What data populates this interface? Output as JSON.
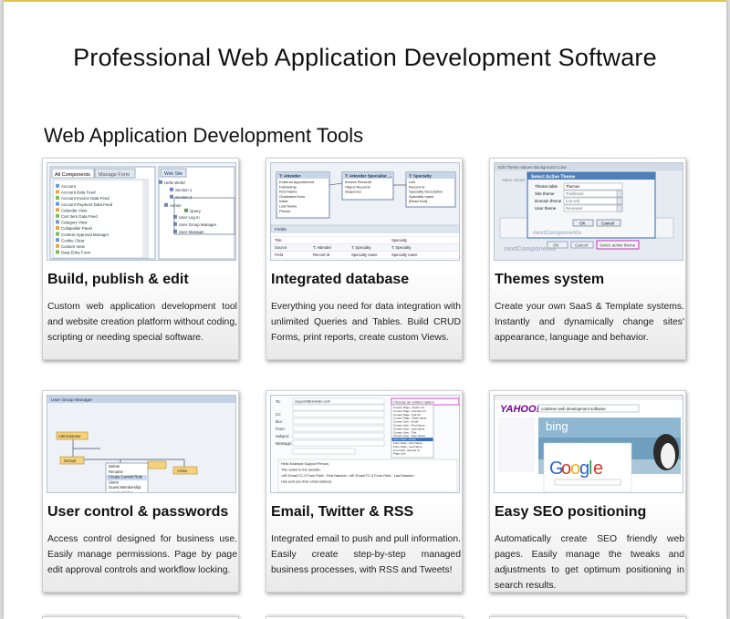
{
  "page": {
    "title": "Professional Web Application Development Software",
    "section_title": "Web Application Development Tools"
  },
  "cards": [
    {
      "title": "Build, publish & edit",
      "description": "Custom web application development tool and website creation platform without coding, scripting or needing special software.",
      "thumb": {
        "tab_active": "All Components",
        "tab_inactive": "Manage Form",
        "right_tab": "Web Site",
        "components": [
          "Account",
          "Account Data Feed",
          "Account Invoice Data Feed",
          "Account Payment Data Feed",
          "Calendar View",
          "Cart Item Data Feed",
          "Category View",
          "Collapsible Panel",
          "Content Approval Manager",
          "Cookie Clear",
          "Custom View",
          "Data Entry Form"
        ],
        "tree": [
          "Hello World",
          "Section 1",
          "Section 2",
          "Admin",
          "Query",
          "User Log In",
          "User Group Manager",
          "User Manager"
        ]
      }
    },
    {
      "title": "Integrated database",
      "description": "Everything you need for data integration with unlimited Queries and Tables. Build CRUD Forms, print reports, create custom Views.",
      "thumb": {
        "tables": [
          "T: Attender",
          "T: Attender Specialist_...",
          "T: Specialty"
        ],
        "table1_fields": [
          "External Appointment",
          "Fellowship",
          "First Name",
          "Graduated from",
          "Initial",
          "Last Name",
          "Picture"
        ],
        "table2_fields": [
          "Invoice Record#",
          "Object Records",
          "Sequence"
        ],
        "table3_fields": [
          "Link",
          "Record Id",
          "Specialty Description",
          "Specialty name",
          "[Read Sort]"
        ],
        "fields_label": "Fields",
        "grid_rows": [
          "Title",
          "Source",
          "Field"
        ],
        "grid_values": [
          "Specialty",
          "T: Attender",
          "T: Specialty",
          "T: Specialty",
          "Record Id",
          "Specialty name",
          "Specialty name"
        ]
      }
    },
    {
      "title": "Themes system",
      "description": "Create your own SaaS & Template systems. Instantly and dynamically change sites' appearance, language and behavior.",
      "thumb": {
        "bg_header": "Edit Theme Values Background Color",
        "dialog_title": "Select Active Theme",
        "dialog_rows": [
          "Theme table",
          "Site theme",
          "Domain theme",
          "User theme"
        ],
        "dialog_values": [
          "Themes",
          "Traditional",
          "(not set)",
          "Reviewed"
        ],
        "ok": "OK",
        "cancel": "Cancel",
        "brand": "nextComponents",
        "select_active": "Select active theme",
        "bg_value": "Value stored"
      }
    },
    {
      "title": "User control & passwords",
      "description": "Access control designed for business use. Easily manage permissions. Page by page edit approval controls and workflow locking.",
      "thumb": {
        "header": "User Group Manager",
        "nodes": [
          "Administrator",
          "Default",
          "Visitor"
        ],
        "menu": [
          "Delete",
          "Rename",
          "Create Control Rule",
          "Users",
          "Guest Membership",
          "Access Codes"
        ]
      }
    },
    {
      "title": "Email, Twitter & RSS",
      "description": "Integrated email to push and pull information. Easily create step-by-step managed business processes, with RSS and Tweets!",
      "thumb": {
        "to_label": "To:",
        "to_value": "support@domain.com",
        "cc_label": "Cc:",
        "bcc_label": "Bcc:",
        "from_label": "From:",
        "subject_label": "Subject:",
        "message_label": "Message:",
        "dropdown": "Choose an embed option",
        "options": [
          "Current Page - Author Url",
          "Current Page - Domain Url",
          "Current Page - Full Url",
          "Current Page - Page Name",
          "Current User - Email",
          "Current User - First Name",
          "Current User - Last Name",
          "Current User - Title",
          "Current User - User Name",
          "Form Field - Email",
          "Form Field - First Name",
          "Form Field - Last Name",
          "Live Field - Record Id",
          "Page Link"
        ],
        "body_lines": [
          "Hello Example Support Person,",
          "This visitor to the website:",
          "<#E-Email-TC-3 Form Field - First Name#> <#E-Email-TC-3 Form Field - Last Name#>",
          "Has sent you their email address."
        ]
      }
    },
    {
      "title": "Easy SEO positioning",
      "description": "Automatically create SEO friendly web pages. Easily manage the tweaks and adjustments to get optimum positioning in search results.",
      "thumb": {
        "yahoo": "YAHOO!",
        "yahoo_query": "codeless web development software",
        "bing": "bing",
        "google": "Google"
      }
    }
  ],
  "colors": {
    "accent_top": "#e2c64a",
    "window_blue": "#4f7fb8",
    "thumb_border": "#b8c4d2"
  }
}
